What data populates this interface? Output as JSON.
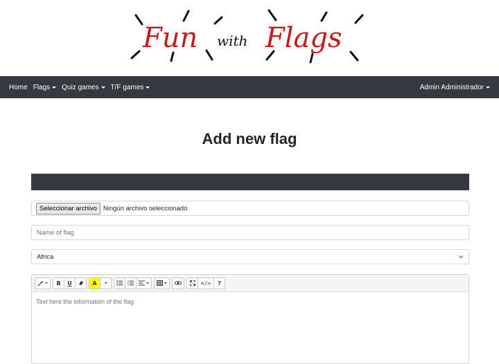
{
  "brand": {
    "logo_text": "Fun with Flags",
    "word_fun": "Fun",
    "word_with": "with",
    "word_flags": "Flags",
    "logo_color": "#c41a1a"
  },
  "navbar": {
    "items": [
      {
        "label": "Home",
        "dropdown": false
      },
      {
        "label": "Flags",
        "dropdown": true
      },
      {
        "label": "Quiz games",
        "dropdown": true
      },
      {
        "label": "T/F games",
        "dropdown": true
      }
    ],
    "user_menu": "Admin Administrador",
    "background": "#343a40"
  },
  "page": {
    "title": "Add new flag"
  },
  "form": {
    "file_button": "Seleccionar archivo",
    "file_status": "Ningún archivo seleccionado",
    "name_placeholder": "Name of flag",
    "continent_selected": "Africa",
    "editor_placeholder": "Text here the information of the flag",
    "toolbar": {
      "style_icon": "magic-wand-icon",
      "bold_label": "B",
      "underline_label": "U",
      "eraser_icon": "eraser-icon",
      "color_label": "A",
      "ul_icon": "unordered-list-icon",
      "ol_icon": "ordered-list-icon",
      "paragraph_icon": "align-icon",
      "table_icon": "table-icon",
      "link_icon": "link-icon",
      "fullscreen_icon": "fullscreen-icon",
      "code_label": "</>",
      "help_label": "?"
    }
  }
}
